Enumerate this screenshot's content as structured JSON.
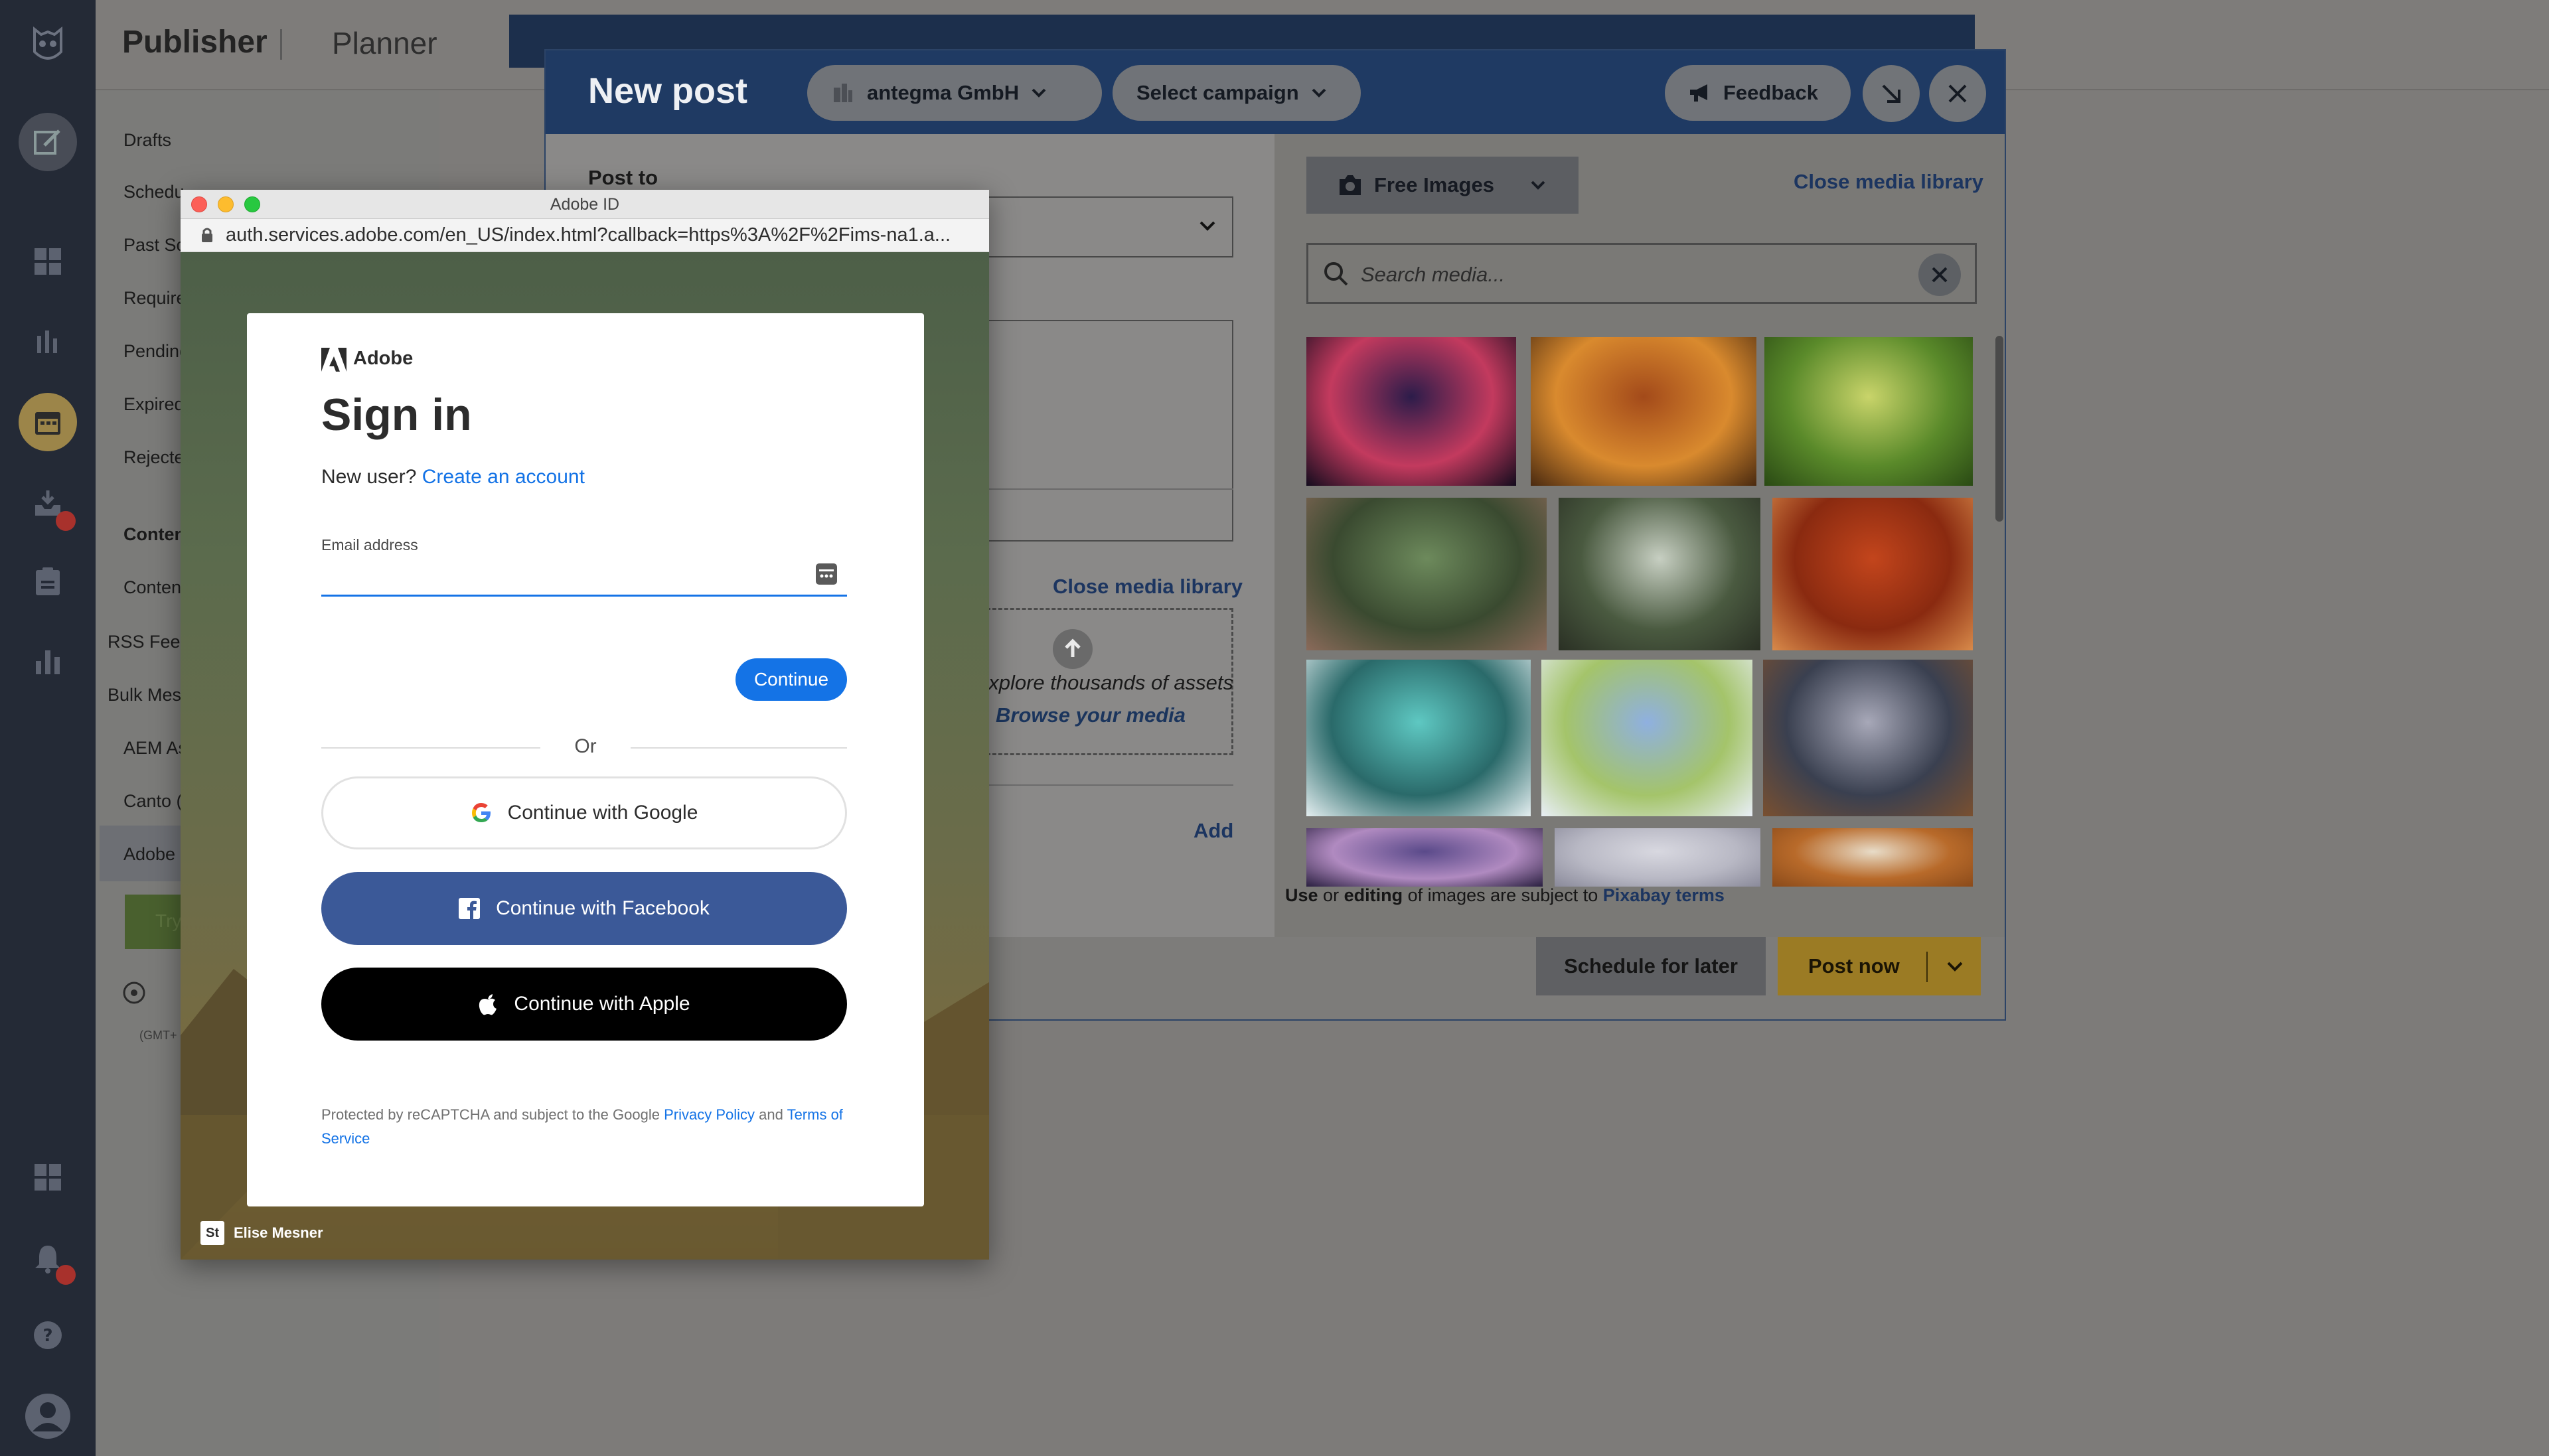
{
  "publisher": {
    "title": "Publisher",
    "planner_tab": "Planner",
    "sidebar": [
      {
        "label": "Drafts",
        "bold": false,
        "out": false
      },
      {
        "label": "Schedu",
        "bold": false,
        "out": false
      },
      {
        "label": "Past Sc",
        "bold": false,
        "out": false
      },
      {
        "label": "Require",
        "bold": false,
        "out": false
      },
      {
        "label": "Pending",
        "bold": false,
        "out": false
      },
      {
        "label": "Expired",
        "bold": false,
        "out": false
      },
      {
        "label": "Rejecte",
        "bold": false,
        "out": false
      },
      {
        "label": "Conten",
        "bold": true,
        "out": false
      },
      {
        "label": "Conten",
        "bold": false,
        "out": false
      },
      {
        "label": "RSS Feeds",
        "bold": false,
        "out": true
      },
      {
        "label": "Bulk Mess",
        "bold": false,
        "out": true
      },
      {
        "label": "AEM As",
        "bold": false,
        "out": false
      },
      {
        "label": "Canto (",
        "bold": false,
        "out": false
      },
      {
        "label": "Adobe (",
        "bold": false,
        "out": false
      }
    ],
    "try_btn": "Try",
    "gmt_text": "(GMT+"
  },
  "composer": {
    "title": "New post",
    "account_pill": "antegma GmbH",
    "campaign_pill": "Select campaign",
    "feedback": "Feedback",
    "post_to_label": "Post to",
    "close_media_library": "Close media library",
    "upload_text": "Explore thousands of assets",
    "browse_media": "Browse your media",
    "add_link": "Add",
    "schedule_for_later": "Schedule for later",
    "post_now": "Post now"
  },
  "media_library": {
    "source_dropdown": "Free Images",
    "close_link": "Close media library",
    "search_placeholder": "Search media...",
    "terms": {
      "use": "Use",
      "or": "or",
      "editing": "editing",
      "rest": "of images are subject to",
      "link": "Pixabay terms"
    },
    "thumbnails": [
      {
        "subject": "tree at sunset",
        "colors": [
          "#2c1c4a",
          "#c33a5e",
          "#140c1e"
        ]
      },
      {
        "subject": "autumn forest path",
        "colors": [
          "#a34a1a",
          "#d98a2e",
          "#4a2a10"
        ]
      },
      {
        "subject": "green meadow with flowers",
        "colors": [
          "#c9d46a",
          "#5a8a2a",
          "#2a4a14"
        ]
      },
      {
        "subject": "misty forest",
        "colors": [
          "#6d8a5c",
          "#3a4a30",
          "#8a6a5a"
        ]
      },
      {
        "subject": "sunlit forest road",
        "colors": [
          "#c7cfc2",
          "#4a5a40",
          "#2a3024"
        ]
      },
      {
        "subject": "red autumn forest",
        "colors": [
          "#c3451c",
          "#8a2a10",
          "#d88a4a"
        ]
      },
      {
        "subject": "dandelion with dew drops",
        "colors": [
          "#5ec8c2",
          "#2a6a6a",
          "#e4eef0"
        ]
      },
      {
        "subject": "butterflies on flowers",
        "colors": [
          "#8fb0e0",
          "#a4c46a",
          "#e8eef6"
        ]
      },
      {
        "subject": "mountain sunset over clouds",
        "colors": [
          "#a7a8b8",
          "#3a4050",
          "#7a5030"
        ]
      },
      {
        "subject": "purple dusk sky",
        "colors": [
          "#5a4a8a",
          "#b08ac0",
          "#2a2040"
        ]
      },
      {
        "subject": "cloudy sky",
        "colors": [
          "#d8d8e0",
          "#b8b8c4",
          "#8a8a9a"
        ]
      },
      {
        "subject": "swan in autumn",
        "colors": [
          "#e8dcc8",
          "#b86a2a",
          "#8a4a1a"
        ]
      }
    ]
  },
  "adobe_window": {
    "window_title": "Adobe ID",
    "url": "auth.services.adobe.com/en_US/index.html?callback=https%3A%2F%2Fims-na1.a...",
    "brand": "Adobe",
    "heading": "Sign in",
    "new_user": "New user?",
    "create_account": "Create an account",
    "email_label": "Email address",
    "continue": "Continue",
    "or": "Or",
    "google": "Continue with Google",
    "facebook": "Continue with Facebook",
    "apple": "Continue with Apple",
    "legal_prefix": "Protected by reCAPTCHA and subject to the Google",
    "privacy": "Privacy Policy",
    "and": "and",
    "terms": "Terms of Service",
    "photo_credit_badge": "St",
    "photo_credit": "Elise Mesner"
  },
  "colors": {
    "adobe_blue": "#1473e6",
    "facebook_blue": "#3b5998",
    "composer_header": "#1f3a63",
    "post_now": "#9b7b24"
  },
  "icons": {
    "rail": [
      "owl-logo-icon",
      "compose-icon",
      "dashboard-icon",
      "streams-icon",
      "planner-icon",
      "inbox-icon",
      "assignments-icon",
      "analytics-icon",
      "apps-icon",
      "notifications-icon",
      "help-icon",
      "profile-icon"
    ],
    "composer": [
      "feedback-megaphone-icon",
      "minimize-icon",
      "close-icon"
    ],
    "media": [
      "camera-icon",
      "chevron-down-icon",
      "search-icon",
      "clear-icon",
      "upload-icon"
    ],
    "adobe": [
      "adobe-logo-icon",
      "google-icon",
      "facebook-icon",
      "apple-icon",
      "lock-icon",
      "password-manager-icon"
    ]
  }
}
